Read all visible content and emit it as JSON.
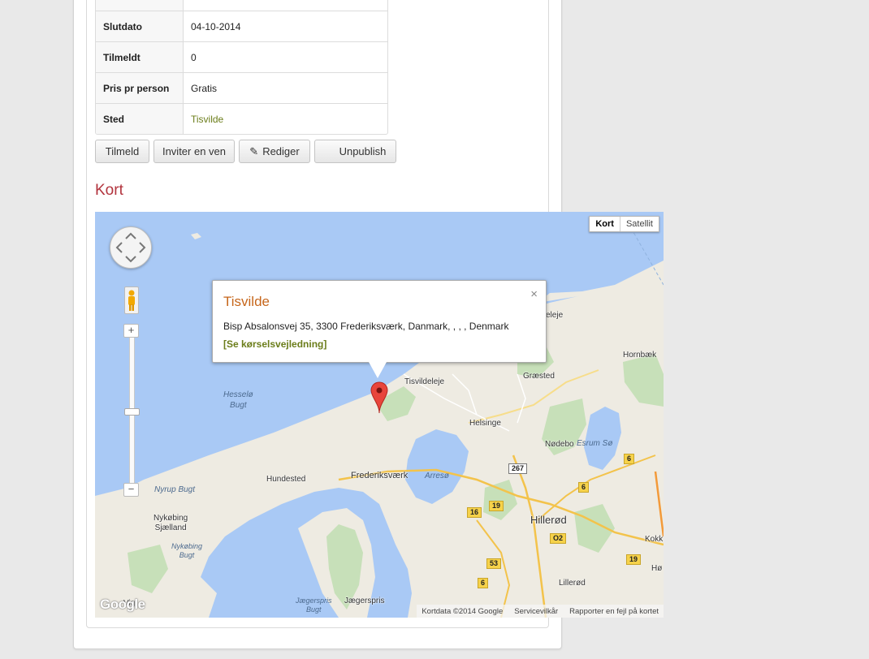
{
  "details": {
    "rows": [
      {
        "label": "",
        "value": ""
      },
      {
        "label": "Slutdato",
        "value": "04-10-2014"
      },
      {
        "label": "Tilmeldt",
        "value": "0"
      },
      {
        "label": "Pris pr person",
        "value": "Gratis"
      },
      {
        "label": "Sted",
        "value": "Tisvilde"
      }
    ]
  },
  "actions": {
    "tilmeld": "Tilmeld",
    "inviter": "Inviter en ven",
    "rediger": "Rediger",
    "unpublish": "Unpublish"
  },
  "section": {
    "map_title": "Kort"
  },
  "map": {
    "maptypes": {
      "map": "Kort",
      "satellite": "Satellit"
    },
    "zoom_in": "+",
    "zoom_out": "−",
    "infowindow": {
      "title": "Tisvilde",
      "address": "Bisp Absalonsvej 35, 3300 Frederiksværk, Danmark, , , , Denmark",
      "directions_link": "[Se kørselsvejledning]",
      "close": "×"
    },
    "places": {
      "tisvildeleje": "Tisvildeleje",
      "helsinge": "Helsinge",
      "graested": "Græsted",
      "hornbaek": "Hornbæk",
      "esrum": "Esrum Sø",
      "nodebo": "Nødebo",
      "frederiksvaerk": "Frederiksværk",
      "arreso": "Arresø",
      "hundested": "Hundested",
      "hillerod": "Hillerød",
      "nykobing": "Nykøbing\nSjælland",
      "nykobing_bugt": "Nykøbing\nBugt",
      "nyrup": "Nyrup Bugt",
      "hesselo": "Hesselø\nBugt",
      "lillerod": "Lillerød",
      "jaegerspris": "Jægerspris",
      "jaegerspris_bugt": "Jægerspris\nBugt",
      "vig": "Vig",
      "eleje": "eleje",
      "kokk": "Kokk",
      "ho": "Hø"
    },
    "roads": {
      "r267": "267",
      "r6a": "6",
      "r6b": "6",
      "r6c": "6",
      "r16": "16",
      "r19a": "19",
      "r19b": "19",
      "r53": "53",
      "r02": "O2"
    },
    "logo": "Google",
    "footer": {
      "data": "Kortdata ©2014 Google",
      "terms": "Servicevilkår",
      "report": "Rapporter en fejl på kortet"
    }
  }
}
